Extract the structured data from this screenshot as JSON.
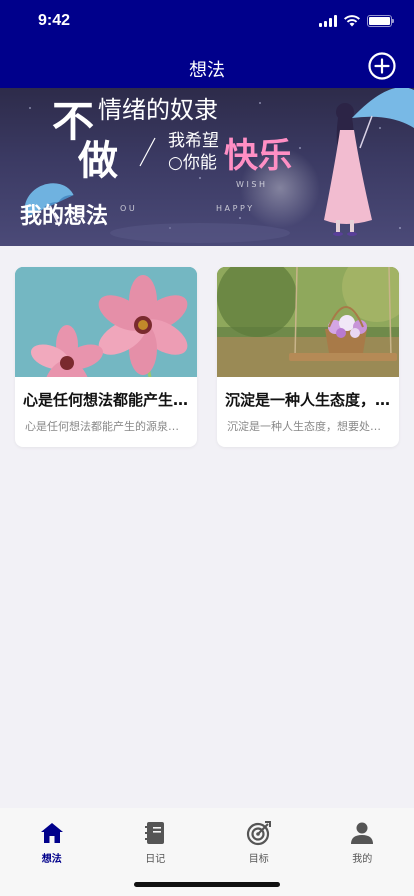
{
  "status_bar": {
    "time": "9:42"
  },
  "nav": {
    "title": "想法",
    "add_icon": "plus-circle-icon"
  },
  "banner": {
    "title": "我的想法",
    "art_text": {
      "line1_big": "不",
      "line1_rest": "情绪的奴隶",
      "line2_big": "做",
      "hope": "我希望",
      "can": "○你能",
      "happy": "快乐",
      "wish": "W I S H",
      "you": "O U",
      "happy_en": "H A P P Y"
    }
  },
  "cards": [
    {
      "title": "心是任何想法都能产生的源泉",
      "desc": "心是任何想法都能产生的源泉，想要处理好"
    },
    {
      "title": "沉淀是一种人生态度，想要处理好",
      "desc": "沉淀是一种人生态度，想要处理好每一件事"
    }
  ],
  "tabs": [
    {
      "label": "想法",
      "icon": "home-icon",
      "active": true
    },
    {
      "label": "日记",
      "icon": "notebook-icon",
      "active": false
    },
    {
      "label": "目标",
      "icon": "target-icon",
      "active": false
    },
    {
      "label": "我的",
      "icon": "person-icon",
      "active": false
    }
  ],
  "colors": {
    "primary": "#00008b",
    "background": "#f2f1f6",
    "inactive_icon": "#555555"
  }
}
